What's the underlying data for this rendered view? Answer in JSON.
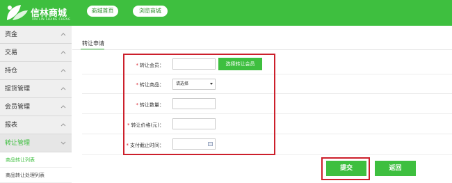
{
  "header": {
    "logo_text": "信林商城",
    "logo_sub": "XIN LIN SHANG CHENG",
    "nav_home": "商城首页",
    "nav_browse": "浏览商城"
  },
  "sidebar": {
    "items": [
      {
        "label": "资金"
      },
      {
        "label": "交易"
      },
      {
        "label": "持仓"
      },
      {
        "label": "提货管理"
      },
      {
        "label": "会员管理"
      },
      {
        "label": "报表"
      },
      {
        "label": "转让管理"
      }
    ],
    "sub_items": [
      {
        "label": "商品转让列表"
      },
      {
        "label": "商品转让处理列表"
      }
    ]
  },
  "tab": {
    "label": "转让申请"
  },
  "form": {
    "member_label": "转让会员：",
    "member_button": "选择转让会员",
    "product_label": "转让商品：",
    "product_select": "请选择",
    "quantity_label": "转让数量：",
    "price_label": "转让价格(元)：",
    "deadline_label": "支付截止时间：",
    "required_mark": "*"
  },
  "actions": {
    "submit": "提交",
    "back": "返回"
  },
  "colors": {
    "brand_green": "#3ebf3f",
    "highlight_red": "#cc1f2b"
  }
}
